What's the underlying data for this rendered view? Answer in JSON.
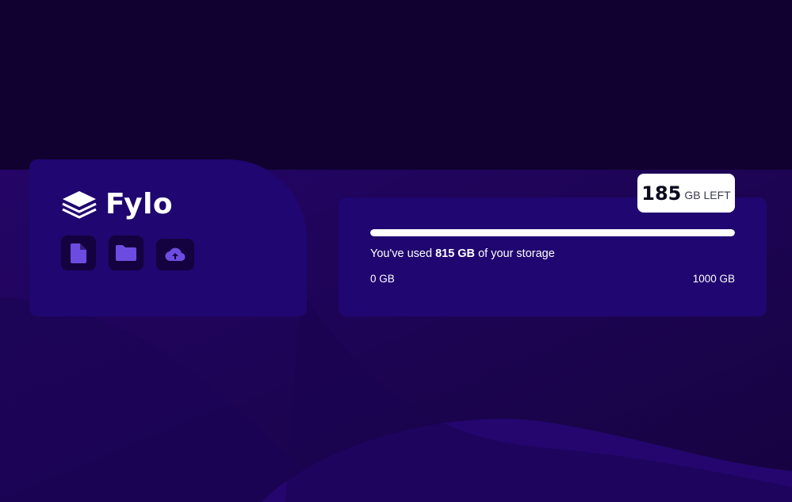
{
  "app": {
    "name": "Fylo"
  },
  "toolbar": {
    "icons": [
      {
        "name": "file-icon"
      },
      {
        "name": "folder-icon"
      },
      {
        "name": "upload-icon"
      }
    ]
  },
  "storage": {
    "remaining_value": "185",
    "remaining_unit": "GB LEFT",
    "used_prefix": "You've used ",
    "used_amount": "815 GB",
    "used_suffix": " of your storage",
    "min_label": "0 GB",
    "max_label": "1000 GB",
    "used_fraction": 1.0
  },
  "colors": {
    "accent": "#6c4ce0",
    "card": "#200670",
    "background": "#110130"
  }
}
